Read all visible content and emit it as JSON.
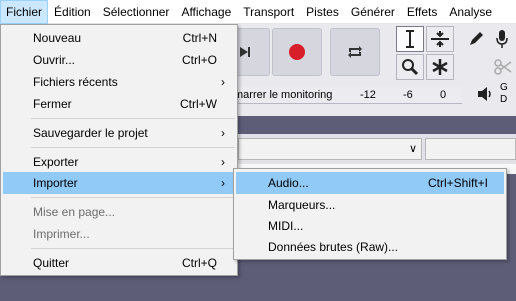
{
  "menubar": {
    "items": [
      {
        "label": "Fichier",
        "open": true
      },
      {
        "label": "Édition"
      },
      {
        "label": "Sélectionner"
      },
      {
        "label": "Affichage"
      },
      {
        "label": "Transport"
      },
      {
        "label": "Pistes"
      },
      {
        "label": "Générer"
      },
      {
        "label": "Effets"
      },
      {
        "label": "Analyse"
      }
    ]
  },
  "background": {
    "meter_text": "marrer le monitoring",
    "meter_ticks": [
      "-12",
      "-6",
      "0"
    ],
    "gd_text": [
      "G",
      "D"
    ],
    "colors": {
      "record": "#d71f2a",
      "menu_highlight": "#91c9f7",
      "menu_bg": "#f2f2f2"
    }
  },
  "file_menu": {
    "items": [
      {
        "label": "Nouveau",
        "shortcut": "Ctrl+N"
      },
      {
        "label": "Ouvrir...",
        "shortcut": "Ctrl+O"
      },
      {
        "label": "Fichiers récents",
        "submenu": true
      },
      {
        "label": "Fermer",
        "shortcut": "Ctrl+W"
      },
      {
        "label": "Sauvegarder le projet",
        "submenu": true
      },
      {
        "label": "Exporter",
        "submenu": true
      },
      {
        "label": "Importer",
        "submenu": true,
        "highlighted": true
      },
      {
        "label": "Mise en page...",
        "disabled": true
      },
      {
        "label": "Imprimer...",
        "disabled": true
      },
      {
        "label": "Quitter",
        "shortcut": "Ctrl+Q"
      }
    ],
    "arrow_glyph": "›"
  },
  "import_submenu": {
    "items": [
      {
        "label": "Audio...",
        "shortcut": "Ctrl+Shift+I",
        "highlighted": true
      },
      {
        "label": "Marqueurs..."
      },
      {
        "label": "MIDI..."
      },
      {
        "label": "Données brutes (Raw)..."
      }
    ]
  }
}
